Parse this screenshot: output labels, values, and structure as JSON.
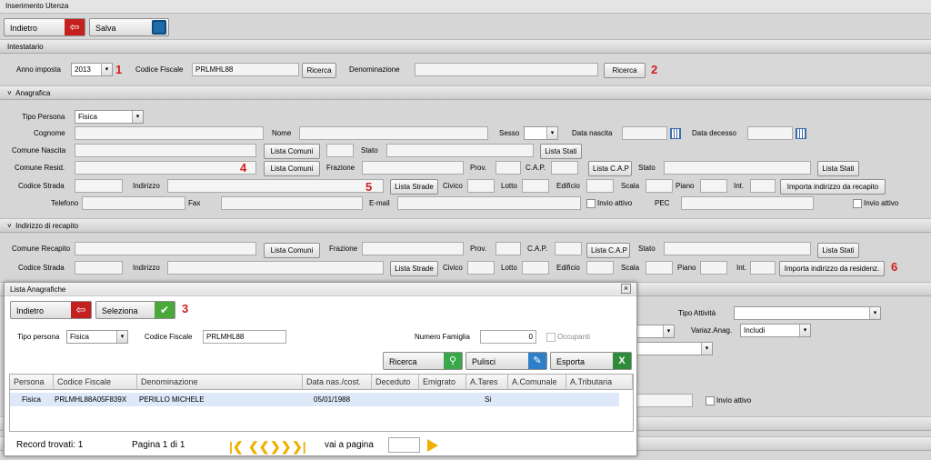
{
  "window_title": "Inserimento Utenza",
  "toolbar": {
    "back": "Indietro",
    "save": "Salva"
  },
  "intestatario": {
    "title": "Intestatario",
    "anno_label": "Anno imposta",
    "anno_value": "2013",
    "cf_label": "Codice Fiscale",
    "cf_value": "PRLMHL88",
    "ricerca": "Ricerca",
    "denominazione_label": "Denominazione",
    "ricerca2": "Ricerca"
  },
  "markers": {
    "m1": "1",
    "m2": "2",
    "m3": "3",
    "m4": "4",
    "m5": "5",
    "m6": "6"
  },
  "anagrafica": {
    "title": "Anagrafica",
    "tipo_persona_label": "Tipo Persona",
    "tipo_persona_value": "Fisica",
    "cognome": "Cognome",
    "nome": "Nome",
    "sesso": "Sesso",
    "data_nascita": "Data nascita",
    "data_decesso": "Data decesso",
    "comune_nascita": "Comune Nascita",
    "lista_comuni": "Lista Comuni",
    "stato": "Stato",
    "lista_stati": "Lista Stati",
    "comune_resid": "Comune Resid.",
    "frazione": "Frazione",
    "prov": "Prov.",
    "cap": "C.A.P.",
    "lista_cap": "Lista C.A.P",
    "codice_strada": "Codice Strada",
    "indirizzo": "Indirizzo",
    "lista_strade": "Lista Strade",
    "civico": "Civico",
    "lotto": "Lotto",
    "edificio": "Edificio",
    "scala": "Scala",
    "piano": "Piano",
    "int": "Int.",
    "importa_recapito": "Importa indirizzo da recapito",
    "telefono": "Telefono",
    "fax": "Fax",
    "email": "E-mail",
    "invio_attivo": "Invio attivo",
    "pec": "PEC"
  },
  "recapito": {
    "title": "Indirizzo di recapito",
    "comune": "Comune Recapito",
    "importa_residenza": "Importa indirizzo da residenz."
  },
  "background": {
    "tipo_attivita": "Tipo Attività",
    "variaz_anag": "Variaz.Anag.",
    "includi": "Includi",
    "invio_attivo": "Invio attivo"
  },
  "dialog": {
    "title": "Lista Anagrafiche",
    "close": "×",
    "back": "Indietro",
    "seleziona": "Seleziona",
    "tipo_persona_label": "Tipo persona",
    "tipo_persona_value": "Fisica",
    "cf_label": "Codice Fiscale",
    "cf_value": "PRLMHL88",
    "numero_famiglia_label": "Numero Famiglia",
    "numero_famiglia_value": "0",
    "occupanti": "Occupanti",
    "ricerca": "Ricerca",
    "pulisci": "Pulisci",
    "esporta": "Esporta",
    "columns": [
      "Persona",
      "Codice Fiscale",
      "Denominazione",
      "Data nas./cost.",
      "Deceduto",
      "Emigrato",
      "A.Tares",
      "A.Comunale",
      "A.Tributaria"
    ],
    "rows": [
      {
        "persona": "Fisica",
        "cf": "PRLMHL88A05F839X",
        "denominazione": "PERILLO MICHELE",
        "data": "05/01/1988",
        "deceduto": "",
        "emigrato": "",
        "tares": "Si",
        "comunale": "",
        "tributaria": ""
      }
    ],
    "record_trovati": "Record trovati:  1",
    "pagina": "Pagina 1 di 1",
    "vai_a_pagina": "vai a pagina"
  },
  "colors": {
    "red_marker": "#d11d1d",
    "selected_row": "#dde8f8",
    "nav_arrows": "#f0b000"
  }
}
